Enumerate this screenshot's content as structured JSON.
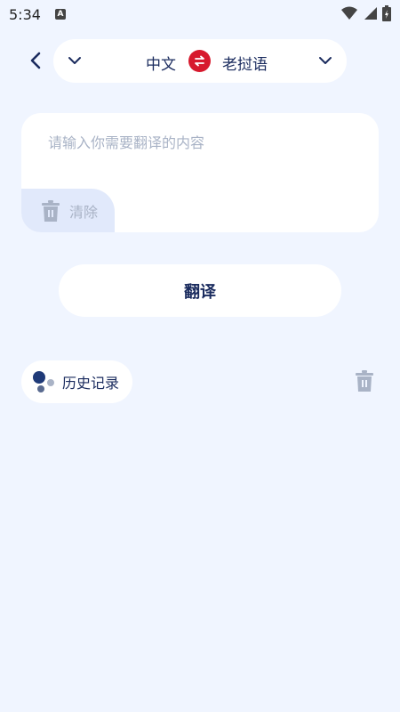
{
  "status_bar": {
    "time": "5:34",
    "a_badge": "A"
  },
  "header": {
    "source_language": "中文",
    "target_language": "老挝语",
    "swap_icon": "swap-icon",
    "back_icon": "chevron-left-icon"
  },
  "input": {
    "placeholder": "请输入你需要翻译的内容",
    "value": "",
    "clear_label": "清除"
  },
  "actions": {
    "translate_label": "翻译"
  },
  "history": {
    "label": "历史记录"
  },
  "colors": {
    "accent": "#d7192d",
    "background": "#f0f5ff",
    "text": "#1a2b5e",
    "muted": "#a9b3c6"
  }
}
